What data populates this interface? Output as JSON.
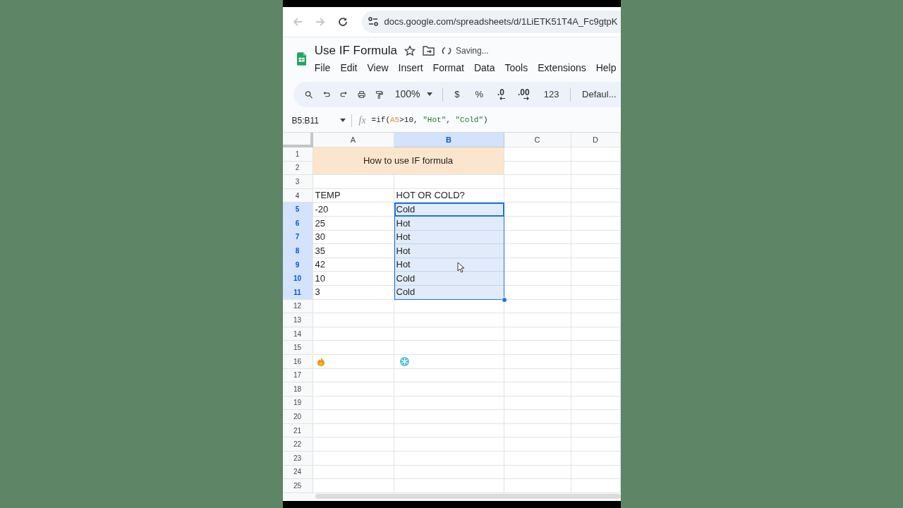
{
  "browser": {
    "url": "docs.google.com/spreadsheets/d/1LiETK51T4A_Fc9gtpK"
  },
  "document": {
    "title": "Use IF Formula",
    "status": "Saving..."
  },
  "menu": [
    "File",
    "Edit",
    "View",
    "Insert",
    "Format",
    "Data",
    "Tools",
    "Extensions",
    "Help"
  ],
  "toolbar": [
    {
      "kind": "search"
    },
    {
      "kind": "undo"
    },
    {
      "kind": "redo"
    },
    {
      "kind": "print"
    },
    {
      "kind": "paint"
    },
    {
      "kind": "dropdown",
      "label": "100%"
    },
    {
      "kind": "divider"
    },
    {
      "kind": "text",
      "label": "$"
    },
    {
      "kind": "text",
      "label": "%"
    },
    {
      "kind": "decrease",
      "label": ".0"
    },
    {
      "kind": "increase",
      "label": ".00"
    },
    {
      "kind": "text",
      "label": "123"
    },
    {
      "kind": "divider"
    },
    {
      "kind": "text",
      "label": "Defaul..."
    }
  ],
  "formula_bar": {
    "name_box": "B5:B11",
    "fx_label": "fx",
    "tokens": [
      {
        "kind": "plain",
        "text": "=if("
      },
      {
        "kind": "ref",
        "text": "A5"
      },
      {
        "kind": "plain",
        "text": ">"
      },
      {
        "kind": "number",
        "text": "10"
      },
      {
        "kind": "plain",
        "text": ", "
      },
      {
        "kind": "string",
        "text": "\"Hot\""
      },
      {
        "kind": "plain",
        "text": ", "
      },
      {
        "kind": "string",
        "text": "\"Cold\""
      },
      {
        "kind": "plain",
        "text": ")"
      }
    ]
  },
  "columns": [
    {
      "label": "A",
      "selected": false
    },
    {
      "label": "B",
      "selected": true
    },
    {
      "label": "C",
      "selected": false
    },
    {
      "label": "D",
      "selected": false
    }
  ],
  "merged_title": {
    "text": "How to use IF formula"
  },
  "rows": [
    {
      "label": "1",
      "selected": false
    },
    {
      "label": "2",
      "selected": false
    },
    {
      "label": "3",
      "selected": false
    },
    {
      "label": "4",
      "selected": false,
      "a": {
        "text": "TEMP",
        "selected": false
      },
      "b": {
        "text": "HOT OR COLD?",
        "selected": false
      }
    },
    {
      "label": "5",
      "selected": true,
      "a": {
        "text": "-20",
        "selected": false
      },
      "b": {
        "text": "Cold",
        "selected": true,
        "active": true
      }
    },
    {
      "label": "6",
      "selected": true,
      "a": {
        "text": "25",
        "selected": false
      },
      "b": {
        "text": "Hot",
        "selected": true,
        "active": false
      }
    },
    {
      "label": "7",
      "selected": true,
      "a": {
        "text": "30",
        "selected": false
      },
      "b": {
        "text": "Hot",
        "selected": true,
        "active": false
      }
    },
    {
      "label": "8",
      "selected": true,
      "a": {
        "text": "35",
        "selected": false
      },
      "b": {
        "text": "Hot",
        "selected": true,
        "active": false
      }
    },
    {
      "label": "9",
      "selected": true,
      "a": {
        "text": "42",
        "selected": false
      },
      "b": {
        "text": "Hot",
        "selected": true,
        "active": false
      }
    },
    {
      "label": "10",
      "selected": true,
      "a": {
        "text": "10",
        "selected": false
      },
      "b": {
        "text": "Cold",
        "selected": true,
        "active": false
      }
    },
    {
      "label": "11",
      "selected": true,
      "a": {
        "text": "3",
        "selected": false
      },
      "b": {
        "text": "Cold",
        "selected": true,
        "active": false
      }
    },
    {
      "label": "12",
      "selected": false
    },
    {
      "label": "13",
      "selected": false
    },
    {
      "label": "14",
      "selected": false
    },
    {
      "label": "15",
      "selected": false
    },
    {
      "label": "16",
      "selected": false,
      "a": {
        "kind": "flame",
        "selected": false
      },
      "b": {
        "kind": "snowflake",
        "selected": false
      }
    },
    {
      "label": "17",
      "selected": false
    },
    {
      "label": "18",
      "selected": false
    },
    {
      "label": "19",
      "selected": false
    },
    {
      "label": "20",
      "selected": false
    },
    {
      "label": "21",
      "selected": false
    },
    {
      "label": "22",
      "selected": false
    },
    {
      "label": "23",
      "selected": false
    },
    {
      "label": "24",
      "selected": false
    },
    {
      "label": "25",
      "selected": false
    }
  ]
}
